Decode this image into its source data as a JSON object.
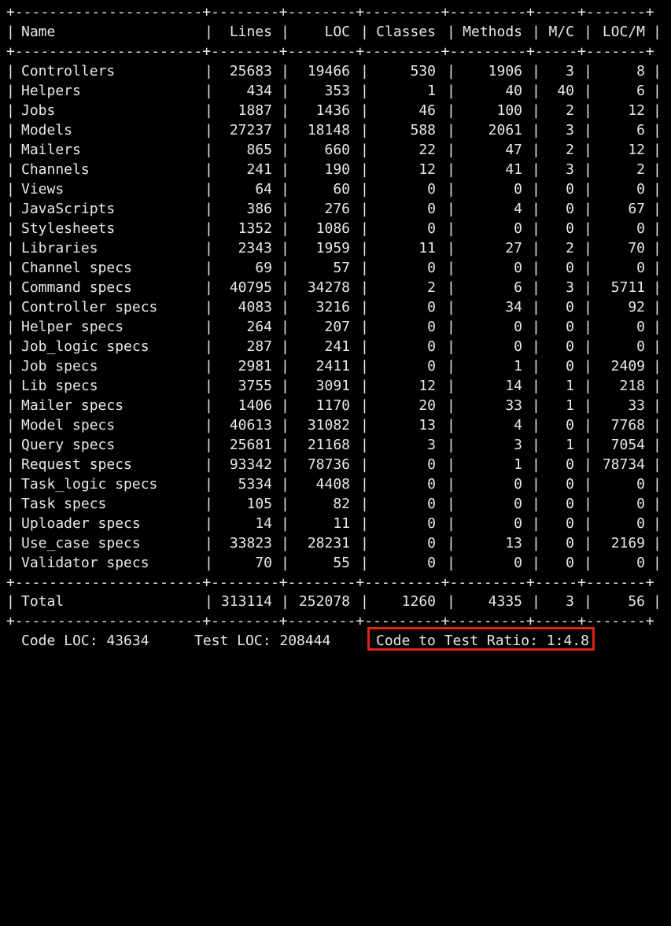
{
  "separator": "+----------------------+--------+--------+---------+---------+-----+-------+",
  "header": {
    "name": "Name",
    "lines": "Lines",
    "loc": "LOC",
    "classes": "Classes",
    "methods": "Methods",
    "mc": "M/C",
    "locm": "LOC/M"
  },
  "rows": [
    {
      "name": "Controllers",
      "lines": "25683",
      "loc": "19466",
      "classes": "530",
      "methods": "1906",
      "mc": "3",
      "locm": "8"
    },
    {
      "name": "Helpers",
      "lines": "434",
      "loc": "353",
      "classes": "1",
      "methods": "40",
      "mc": "40",
      "locm": "6"
    },
    {
      "name": "Jobs",
      "lines": "1887",
      "loc": "1436",
      "classes": "46",
      "methods": "100",
      "mc": "2",
      "locm": "12"
    },
    {
      "name": "Models",
      "lines": "27237",
      "loc": "18148",
      "classes": "588",
      "methods": "2061",
      "mc": "3",
      "locm": "6"
    },
    {
      "name": "Mailers",
      "lines": "865",
      "loc": "660",
      "classes": "22",
      "methods": "47",
      "mc": "2",
      "locm": "12"
    },
    {
      "name": "Channels",
      "lines": "241",
      "loc": "190",
      "classes": "12",
      "methods": "41",
      "mc": "3",
      "locm": "2"
    },
    {
      "name": "Views",
      "lines": "64",
      "loc": "60",
      "classes": "0",
      "methods": "0",
      "mc": "0",
      "locm": "0"
    },
    {
      "name": "JavaScripts",
      "lines": "386",
      "loc": "276",
      "classes": "0",
      "methods": "4",
      "mc": "0",
      "locm": "67"
    },
    {
      "name": "Stylesheets",
      "lines": "1352",
      "loc": "1086",
      "classes": "0",
      "methods": "0",
      "mc": "0",
      "locm": "0"
    },
    {
      "name": "Libraries",
      "lines": "2343",
      "loc": "1959",
      "classes": "11",
      "methods": "27",
      "mc": "2",
      "locm": "70"
    },
    {
      "name": "Channel specs",
      "lines": "69",
      "loc": "57",
      "classes": "0",
      "methods": "0",
      "mc": "0",
      "locm": "0"
    },
    {
      "name": "Command specs",
      "lines": "40795",
      "loc": "34278",
      "classes": "2",
      "methods": "6",
      "mc": "3",
      "locm": "5711"
    },
    {
      "name": "Controller specs",
      "lines": "4083",
      "loc": "3216",
      "classes": "0",
      "methods": "34",
      "mc": "0",
      "locm": "92"
    },
    {
      "name": "Helper specs",
      "lines": "264",
      "loc": "207",
      "classes": "0",
      "methods": "0",
      "mc": "0",
      "locm": "0"
    },
    {
      "name": "Job_logic specs",
      "lines": "287",
      "loc": "241",
      "classes": "0",
      "methods": "0",
      "mc": "0",
      "locm": "0"
    },
    {
      "name": "Job specs",
      "lines": "2981",
      "loc": "2411",
      "classes": "0",
      "methods": "1",
      "mc": "0",
      "locm": "2409"
    },
    {
      "name": "Lib specs",
      "lines": "3755",
      "loc": "3091",
      "classes": "12",
      "methods": "14",
      "mc": "1",
      "locm": "218"
    },
    {
      "name": "Mailer specs",
      "lines": "1406",
      "loc": "1170",
      "classes": "20",
      "methods": "33",
      "mc": "1",
      "locm": "33"
    },
    {
      "name": "Model specs",
      "lines": "40613",
      "loc": "31082",
      "classes": "13",
      "methods": "4",
      "mc": "0",
      "locm": "7768"
    },
    {
      "name": "Query specs",
      "lines": "25681",
      "loc": "21168",
      "classes": "3",
      "methods": "3",
      "mc": "1",
      "locm": "7054"
    },
    {
      "name": "Request specs",
      "lines": "93342",
      "loc": "78736",
      "classes": "0",
      "methods": "1",
      "mc": "0",
      "locm": "78734"
    },
    {
      "name": "Task_logic specs",
      "lines": "5334",
      "loc": "4408",
      "classes": "0",
      "methods": "0",
      "mc": "0",
      "locm": "0"
    },
    {
      "name": "Task specs",
      "lines": "105",
      "loc": "82",
      "classes": "0",
      "methods": "0",
      "mc": "0",
      "locm": "0"
    },
    {
      "name": "Uploader specs",
      "lines": "14",
      "loc": "11",
      "classes": "0",
      "methods": "0",
      "mc": "0",
      "locm": "0"
    },
    {
      "name": "Use_case specs",
      "lines": "33823",
      "loc": "28231",
      "classes": "0",
      "methods": "13",
      "mc": "0",
      "locm": "2169"
    },
    {
      "name": "Validator specs",
      "lines": "70",
      "loc": "55",
      "classes": "0",
      "methods": "0",
      "mc": "0",
      "locm": "0"
    }
  ],
  "total": {
    "name": "Total",
    "lines": "313114",
    "loc": "252078",
    "classes": "1260",
    "methods": "4335",
    "mc": "3",
    "locm": "56"
  },
  "summary": {
    "code_loc": "Code LOC: 43634",
    "test_loc": "Test LOC: 208444",
    "ratio": "Code to Test Ratio: 1:4.8"
  },
  "colors": {
    "background": "#000000",
    "text": "#e8e8e8",
    "highlight_border": "#e2231a"
  }
}
